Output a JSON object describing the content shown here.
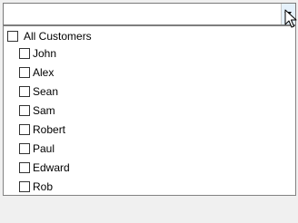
{
  "combo": {
    "value": ""
  },
  "root_item": {
    "label": "All Customers",
    "checked": false
  },
  "children": [
    {
      "label": "John",
      "checked": false
    },
    {
      "label": "Alex",
      "checked": false
    },
    {
      "label": "Sean",
      "checked": false
    },
    {
      "label": "Sam",
      "checked": false
    },
    {
      "label": "Robert",
      "checked": false
    },
    {
      "label": "Paul",
      "checked": false
    },
    {
      "label": "Edward",
      "checked": false
    },
    {
      "label": "Rob",
      "checked": false
    }
  ]
}
